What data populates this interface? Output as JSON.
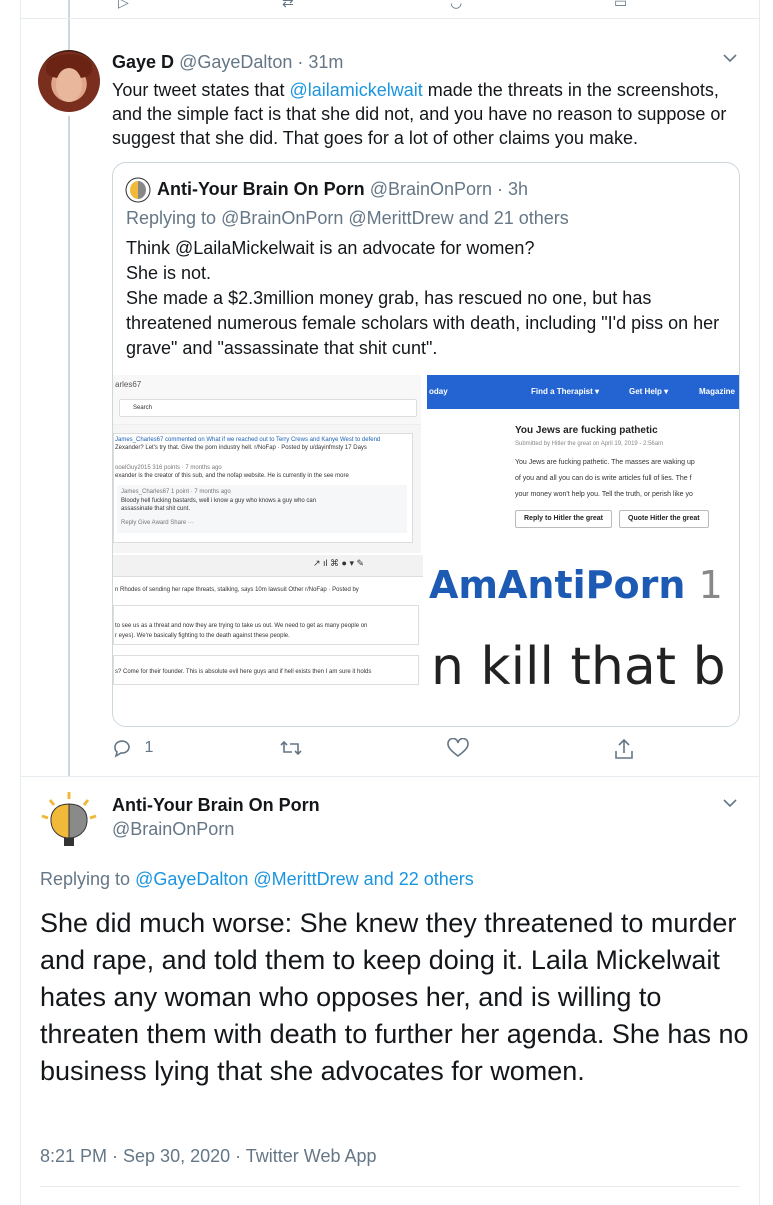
{
  "tweet1": {
    "name": "Gaye D",
    "handle": "@GayeDalton",
    "time": "· 31m",
    "text_before": "Your tweet states that ",
    "mention": "@lailamickelwait",
    "text_after": " made the threats in the screenshots, and the simple fact is that she did not, and you have no reason to suppose or suggest that she did. That goes for a lot of other claims you make.",
    "replies": "1"
  },
  "quoted": {
    "name": "Anti-Your Brain On Porn",
    "handle": "@BrainOnPorn",
    "time": "· 3h",
    "replying_prefix": "Replying to ",
    "replying_mentions": "@BrainOnPorn @MerittDrew and 21 others",
    "lines": [
      "Think @LailaMickelwait is an advocate for women?",
      "She is not.",
      "She made a $2.3million money grab, has rescued no one, but has threatened numerous female scholars with death, including \"I'd piss on her grave\" and \"assassinate that shit cunt\"."
    ],
    "media": {
      "m1_user": "arles67",
      "m1_search": "Search",
      "m1_l1": "James_Charles67 commented on What if we reached out to Terry Crews and Kanye West to defend",
      "m1_l2": "Zexander? Let's try that. Give the porn industry hell.  r/NoFap · Posted by u/dayinfmsty  17 Days",
      "m1_l3": "ooelGuy2015  316 points · 7 months ago",
      "m1_l4": "exander is the creator of this sub, and the nofap website. He is currently in the  see more",
      "m1_l5": "James_Charles67  1 point · 7 months ago",
      "m1_l6": "Bloody hell fucking bastards, well i know a guy who knows a guy who can",
      "m1_l7": "assassinate that shit cunt.",
      "m1_l8": "Reply  Give Award  Share  ···",
      "m2_logo": "oday",
      "m2_nav1": "Find a Therapist ▾",
      "m2_nav2": "Get Help ▾",
      "m2_nav3": "Magazine",
      "m2_title": "You Jews are fucking pathetic",
      "m2_sub": "Submitted by Hitler the great on April 19, 2019 - 2:56am",
      "m2_b1": "You Jews are fucking pathetic. The masses are waking up",
      "m2_b2": "of you and all you can do is write articles full of lies. The f",
      "m2_b3": "your money won't help you. Tell the truth, or perish like yo",
      "m2_btn1": "Reply to Hitler the great",
      "m2_btn2": "Quote Hitler the great",
      "m3_l1": "n Rhodes of sending her rape threats, stalking, says 10m lawsuit   Other   r/NoFap · Posted by",
      "m3_l2": "to see us as a threat and now they are trying to take us out. We need to get as many people on",
      "m3_l3": "r eyes). We're basically fighting to the death against these people.",
      "m3_l4": "s? Come for their founder. This is absolute evil here guys and if hell exists then I am sure it holds",
      "m4_big1": "AmAntiPorn",
      "m4_num": "1",
      "m4_big2": "n kill that b"
    }
  },
  "tweet2": {
    "name": "Anti-Your Brain On Porn",
    "handle": "@BrainOnPorn",
    "replying_prefix": "Replying to ",
    "replying_mentions": "@GayeDalton @MerittDrew and 22 others",
    "text": "She did much worse: She knew they threatened to murder and rape, and told them to keep doing it. Laila Mickelwait hates any woman who opposes her, and is willing to threaten them with death to further her agenda. She has no business lying that she advocates for women.",
    "meta": "8:21 PM · Sep 30, 2020 · Twitter Web App"
  },
  "colors": {
    "link": "#1b95e0",
    "muted": "#657786",
    "border": "#e6ecf0"
  },
  "icons": [
    "reply-icon",
    "retweet-icon",
    "like-icon",
    "share-icon",
    "chevron-down-icon"
  ]
}
